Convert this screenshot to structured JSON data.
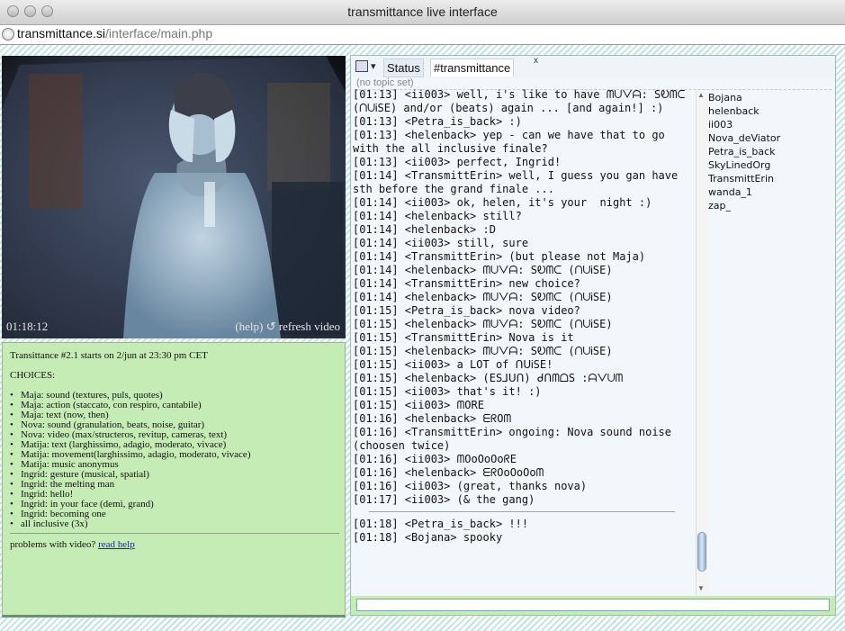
{
  "window": {
    "title": "transmittance live interface"
  },
  "browser": {
    "url_host": "transmittance.si",
    "url_path": "/interface/main.php"
  },
  "video": {
    "timestamp": "01:18:12",
    "help_label": "(help)",
    "refresh_label": "↺ refresh video"
  },
  "info": {
    "start_text": "Transittance #2.1 starts on 2/jun at 23:30 pm CET",
    "choices_heading": "CHOICES:",
    "choices": [
      "Maja: sound (textures, puls, quotes)",
      "Maja: action (staccato, con respiro, cantabile)",
      "Maja: text (now, then)",
      "Nova: sound (granulation, beats, noise, guitar)",
      "Nova: video (max/structeros, revitup, cameras, text)",
      "Matija: text (larghissimo, adagio, moderato, vivace)",
      "Matija: movement(larghissimo, adagio, moderato, vivace)",
      "Matija: music anonymus",
      "Ingrid: gesture (musical, spatial)",
      "Ingrid: the melting man",
      "Ingrid: hello!",
      "Ingrid: in your face (demi, grand)",
      "Ingrid: becoming one",
      "all inclusive (3x)"
    ],
    "problems_text": "problems with video?",
    "problems_link": "read help"
  },
  "chat": {
    "menu_icon": "chat-menu-icon",
    "tabs": {
      "status": "Status",
      "channel": "#transmittance",
      "close": "x"
    },
    "topic": "(no topic set)",
    "messages": [
      "[01:13] <ii003> well, i's like to have ᗰᑌᐯᗩ: SᎧᗰᑕ (ᑎᑌᎥSE) and/or (beats) again ... [and again!] :)",
      "[01:13] <Petra_is_back> :)",
      "[01:13] <helenback> yep - can we have that to go with the all inclusive finale?",
      "[01:13] <ii003> perfect, Ingrid!",
      "[01:14] <TransmittErin> well, I guess you gan have sth before the grand finale ...",
      "[01:14] <ii003> ok, helen, it's your  night :)",
      "[01:14] <helenback> still?",
      "[01:14] <helenback> :D",
      "[01:14] <ii003> still, sure",
      "[01:14] <TransmittErin> (but please not Maja)",
      "[01:14] <helenback> ᗰᑌᐯᗩ: SᎧᗰᑕ (ᑎᑌᎥSE)",
      "[01:14] <TransmittErin> new choice?",
      "[01:14] <helenback> ᗰᑌᐯᗩ: SᎧᗰᑕ (ᑎᑌᎥSE)",
      "[01:15] <Petra_is_back> nova video?",
      "[01:15] <helenback> ᗰᑌᐯᗩ: SᎧᗰᑕ (ᑎᑌᎥSE)",
      "[01:15] <TransmittErin> Nova is it",
      "[01:15] <helenback> ᗰᑌᐯᗩ: SᎧᗰᑕ (ᑎᑌᎥSE)",
      "[01:15] <ii003> a LOT of ᑎᑌᎥSE!",
      "[01:15] <helenback> (ES⅃ᑌᑎ) ᑯᑎᗰᗝS :ᗩᐯᑌᗰ",
      "[01:15] <ii003> that's it! :)",
      "[01:15] <ii003> ᗰORE",
      "[01:16] <helenback> ᗴᖇOᗰ",
      "[01:16] <TransmittErin> ongoing: Nova sound noise (choosen twice)",
      "[01:16] <ii003> ᗰOoOoOoᖇE",
      "[01:16] <helenback> ᗴᖇOoOoOoᗰ",
      "[01:16] <ii003> (great, thanks nova)",
      "[01:17] <ii003> (& the gang)"
    ],
    "late_messages": [
      "[01:18] <Petra_is_back> !!!",
      "[01:18] <Bojana> spooky"
    ],
    "users": [
      "Bojana",
      "helenback",
      "ii003",
      "Nova_deViator",
      "Petra_is_back",
      "SkyLinedOrg",
      "TransmittErin",
      "wanda_1",
      "zap_"
    ],
    "input_value": ""
  },
  "colors": {
    "info_bg": "#c6ecb5",
    "chat_bg": "#f2f7fb",
    "stripe": "#bfe3e3",
    "link": "#1a1adc"
  }
}
